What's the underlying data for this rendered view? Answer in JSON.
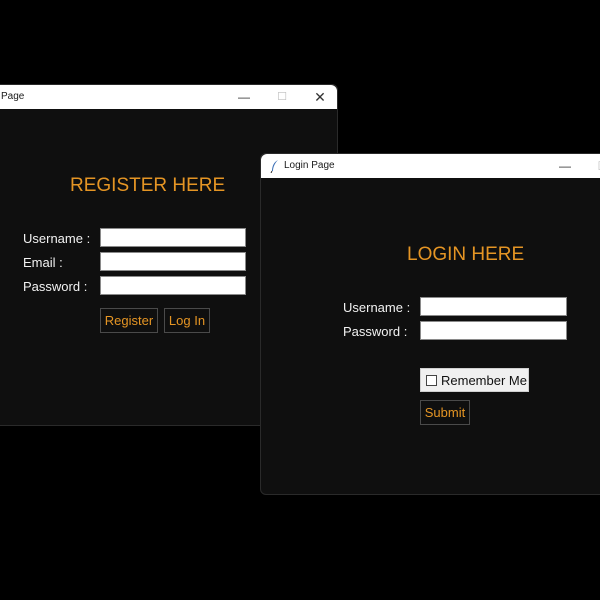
{
  "register_window": {
    "title": "Page",
    "heading": "REGISTER HERE",
    "fields": [
      {
        "label": "Username :",
        "value": ""
      },
      {
        "label": "Email :",
        "value": ""
      },
      {
        "label": "Password :",
        "value": ""
      }
    ],
    "register_label": "Register",
    "login_label": "Log In",
    "controls": {
      "minimize": "—",
      "maximize": "☐",
      "close": "✕"
    }
  },
  "login_window": {
    "title": "Login Page",
    "heading": "LOGIN HERE",
    "fields": [
      {
        "label": "Username :",
        "value": ""
      },
      {
        "label": "Password :",
        "value": ""
      }
    ],
    "remember_label": "Remember Me",
    "remember_checked": false,
    "submit_label": "Submit",
    "controls": {
      "minimize": "—"
    }
  },
  "colors": {
    "accent": "#e59524",
    "window_bg": "#0f0f0f",
    "desktop_bg": "#000000",
    "text": "#f2f2f2"
  },
  "icons": {
    "app_icon": "feather-icon"
  }
}
